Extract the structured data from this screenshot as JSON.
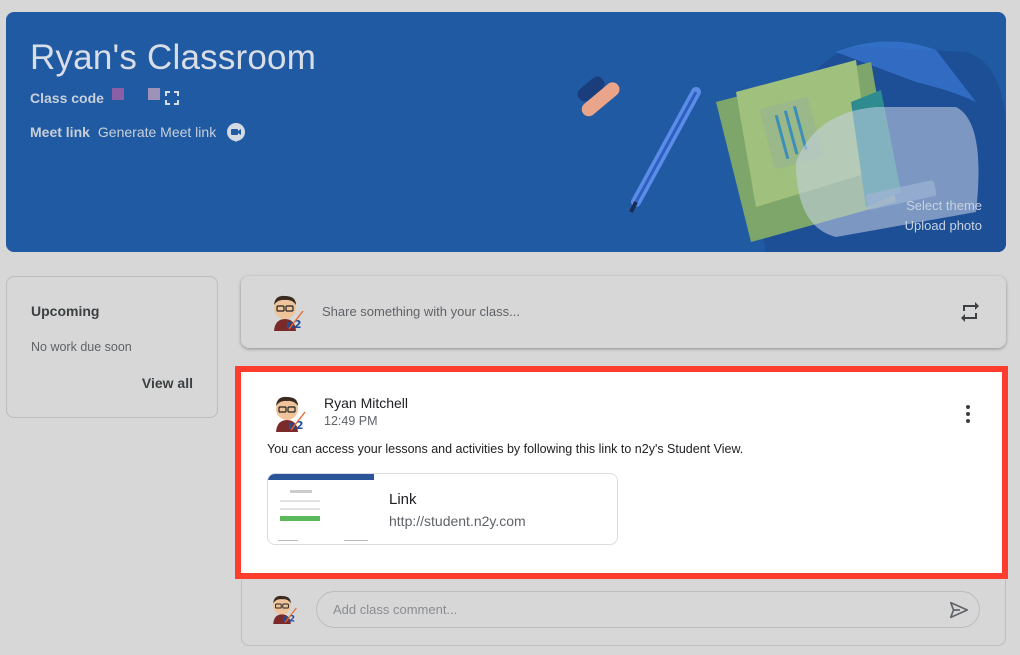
{
  "banner": {
    "title": "Ryan's Classroom",
    "class_code_label": "Class code",
    "meet_label": "Meet link",
    "meet_action": "Generate Meet link",
    "select_theme": "Select theme",
    "upload_photo": "Upload photo",
    "background_color": "#1f5aa3"
  },
  "upcoming": {
    "title": "Upcoming",
    "empty_text": "No work due soon",
    "view_all": "View all"
  },
  "share": {
    "placeholder": "Share something with your class..."
  },
  "post": {
    "author": "Ryan Mitchell",
    "time": "12:49 PM",
    "body": "You can access your lessons and activities by following this link to n2y's Student View.",
    "attachment": {
      "title": "Link",
      "url": "http://student.n2y.com"
    },
    "highlight_color": "#ff3d2e"
  },
  "comment": {
    "placeholder": "Add class comment..."
  },
  "icons": {
    "expand": "expand-icon",
    "meet": "video-camera-icon",
    "repost": "repost-icon",
    "more": "more-vertical-icon",
    "send": "send-icon"
  }
}
